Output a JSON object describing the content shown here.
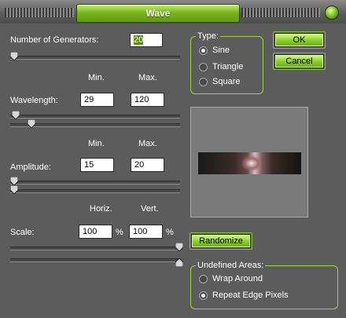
{
  "window": {
    "title": "Wave"
  },
  "generators": {
    "label": "Number of Generators:",
    "value": "20"
  },
  "col_headers": {
    "min": "Min.",
    "max": "Max.",
    "horiz": "Horiz.",
    "vert": "Vert."
  },
  "wavelength": {
    "label": "Wavelength:",
    "min": "29",
    "max": "120"
  },
  "amplitude": {
    "label": "Amplitude:",
    "min": "15",
    "max": "20"
  },
  "scale": {
    "label": "Scale:",
    "horiz": "100",
    "vert": "100",
    "unit": "%"
  },
  "type": {
    "title": "Type:",
    "options": [
      "Sine",
      "Triangle",
      "Square"
    ],
    "selected": "Sine"
  },
  "buttons": {
    "ok": "OK",
    "cancel": "Cancel",
    "randomize": "Randomize"
  },
  "undefined_areas": {
    "title": "Undefined Areas:",
    "options": [
      "Wrap Around",
      "Repeat Edge Pixels"
    ],
    "selected": "Repeat Edge Pixels"
  },
  "colors": {
    "accent": "#8fd12d",
    "background": "#5c5c5c"
  },
  "icons": {
    "close": "close-icon"
  }
}
